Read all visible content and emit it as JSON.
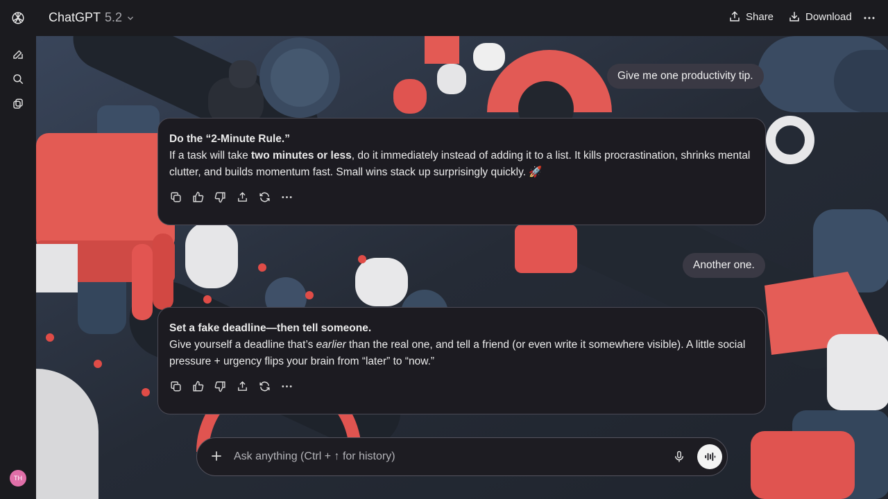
{
  "header": {
    "model_name": "ChatGPT",
    "model_version": "5.2",
    "share_label": "Share",
    "download_label": "Download"
  },
  "sidebar": {
    "avatar_initials": "TH"
  },
  "conversation": {
    "messages": [
      {
        "role": "user",
        "text": "Give me one productivity tip."
      },
      {
        "role": "assistant",
        "title": "Do the “2-Minute Rule.”",
        "p1": "If a task will take ",
        "bold": "two minutes or less",
        "p2": ", do it immediately instead of adding it to a list. It kills procrastination, shrinks mental clutter, and builds momentum fast. Small wins stack up surprisingly quickly. 🚀"
      },
      {
        "role": "user",
        "text": "Another one."
      },
      {
        "role": "assistant",
        "title": "Set a fake deadline—then tell someone.",
        "p1": "Give yourself a deadline that’s ",
        "italic": "earlier",
        "p2": " than the real one, and tell a friend (or even write it somewhere visible). A little social pressure + urgency flips your brain from “later” to “now.”"
      }
    ]
  },
  "composer": {
    "placeholder": "Ask anything (Ctrl + ↑ for history)"
  },
  "colors": {
    "accent_red": "#e05550",
    "navy": "#34495e",
    "background": "#1b1b1f"
  }
}
